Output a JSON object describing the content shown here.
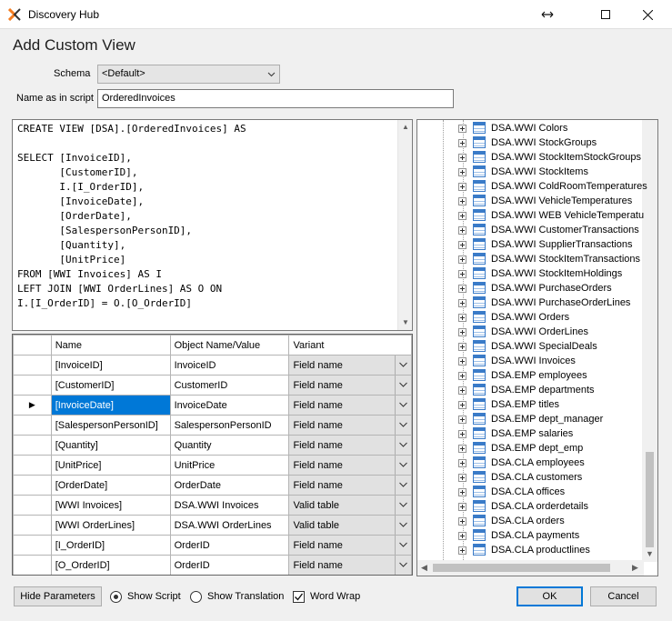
{
  "window": {
    "title": "Discovery Hub"
  },
  "form": {
    "title": "Add Custom View",
    "schema_label": "Schema",
    "schema_value": "<Default>",
    "name_label": "Name as in script",
    "name_value": "OrderedInvoices"
  },
  "script": {
    "text": "CREATE VIEW [DSA].[OrderedInvoices] AS\n\nSELECT [InvoiceID],\n       [CustomerID],\n       I.[I_OrderID],\n       [InvoiceDate],\n       [OrderDate],\n       [SalespersonPersonID],\n       [Quantity],\n       [UnitPrice]\nFROM [WWI Invoices] AS I\nLEFT JOIN [WWI OrderLines] AS O ON\nI.[I_OrderID] = O.[O_OrderID]"
  },
  "grid": {
    "columns": [
      "Name",
      "Object Name/Value",
      "Variant"
    ],
    "rows": [
      {
        "name": "[InvoiceID]",
        "object": "InvoiceID",
        "variant": "Field name"
      },
      {
        "name": "[CustomerID]",
        "object": "CustomerID",
        "variant": "Field name"
      },
      {
        "name": "[InvoiceDate]",
        "object": "InvoiceDate",
        "variant": "Field name"
      },
      {
        "name": "[SalespersonPersonID]",
        "object": "SalespersonPersonID",
        "variant": "Field name"
      },
      {
        "name": "[Quantity]",
        "object": "Quantity",
        "variant": "Field name"
      },
      {
        "name": "[UnitPrice]",
        "object": "UnitPrice",
        "variant": "Field name"
      },
      {
        "name": "[OrderDate]",
        "object": "OrderDate",
        "variant": "Field name"
      },
      {
        "name": "[WWI Invoices]",
        "object": "DSA.WWI Invoices",
        "variant": "Valid table"
      },
      {
        "name": "[WWI OrderLines]",
        "object": "DSA.WWI OrderLines",
        "variant": "Valid table"
      },
      {
        "name": "[I_OrderID]",
        "object": "OrderID",
        "variant": "Field name"
      },
      {
        "name": "[O_OrderID]",
        "object": "OrderID",
        "variant": "Field name"
      }
    ],
    "selected_row": 2
  },
  "tree": {
    "items": [
      "DSA.WWI Colors",
      "DSA.WWI StockGroups",
      "DSA.WWI StockItemStockGroups",
      "DSA.WWI StockItems",
      "DSA.WWI ColdRoomTemperatures",
      "DSA.WWI VehicleTemperatures",
      "DSA.WWI WEB VehicleTemperatu",
      "DSA.WWI CustomerTransactions",
      "DSA.WWI SupplierTransactions",
      "DSA.WWI StockItemTransactions",
      "DSA.WWI StockItemHoldings",
      "DSA.WWI PurchaseOrders",
      "DSA.WWI PurchaseOrderLines",
      "DSA.WWI Orders",
      "DSA.WWI OrderLines",
      "DSA.WWI SpecialDeals",
      "DSA.WWI Invoices",
      "DSA.EMP employees",
      "DSA.EMP departments",
      "DSA.EMP titles",
      "DSA.EMP dept_manager",
      "DSA.EMP salaries",
      "DSA.EMP dept_emp",
      "DSA.CLA employees",
      "DSA.CLA customers",
      "DSA.CLA offices",
      "DSA.CLA orderdetails",
      "DSA.CLA orders",
      "DSA.CLA payments",
      "DSA.CLA productlines"
    ]
  },
  "footer": {
    "hide_parameters": "Hide Parameters",
    "show_script": "Show Script",
    "show_translation": "Show Translation",
    "word_wrap": "Word Wrap",
    "show_script_selected": true,
    "word_wrap_checked": true,
    "ok": "OK",
    "cancel": "Cancel"
  },
  "colors": {
    "accent": "#0078d7",
    "logo_orange": "#f47c20"
  }
}
